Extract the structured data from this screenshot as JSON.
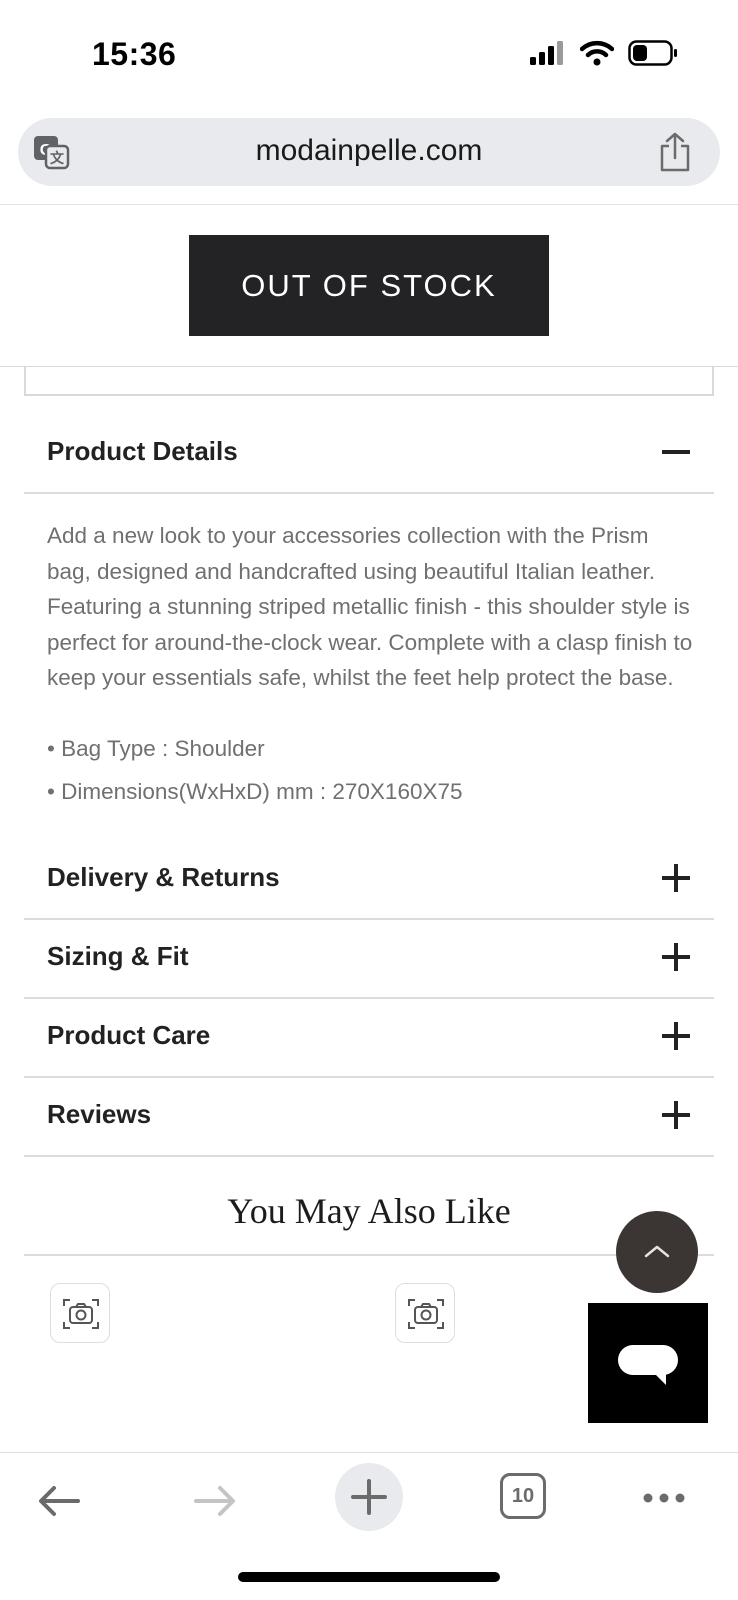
{
  "status_bar": {
    "time": "15:36"
  },
  "address_bar": {
    "url": "modainpelle.com"
  },
  "product": {
    "out_of_stock_label": "OUT OF STOCK",
    "details": {
      "title": "Product Details",
      "description": "Add a new look to your accessories collection with the Prism bag, designed and handcrafted using beautiful Italian leather. Featuring a stunning striped metallic finish - this shoulder style is perfect for around-the-clock wear. Complete with a clasp finish to keep your essentials safe, whilst the feet help protect the base.",
      "bullets": [
        "• Bag Type : Shoulder",
        "• Dimensions(WxHxD) mm : 270X160X75"
      ]
    },
    "sections": [
      {
        "title": "Delivery & Returns",
        "expanded": false
      },
      {
        "title": "Sizing & Fit",
        "expanded": false
      },
      {
        "title": "Product Care",
        "expanded": false
      },
      {
        "title": "Reviews",
        "expanded": false
      }
    ]
  },
  "recommendations": {
    "title": "You May Also Like"
  },
  "toolbar": {
    "tab_count": "10"
  },
  "icons": {
    "translate": "translate-icon",
    "share": "share-icon",
    "collapse": "minus-icon",
    "expand": "plus-icon",
    "visual_search": "camera-icon",
    "scroll_top": "chevron-up-icon",
    "chat": "chat-bubble-icon",
    "back": "arrow-left-icon",
    "forward": "arrow-right-icon",
    "new_tab": "plus-icon",
    "tabs": "tabs-icon",
    "more": "more-icon"
  },
  "colors": {
    "button_dark": "#232325",
    "body_text": "#707070",
    "scroll_top_bg": "#3b3533"
  }
}
